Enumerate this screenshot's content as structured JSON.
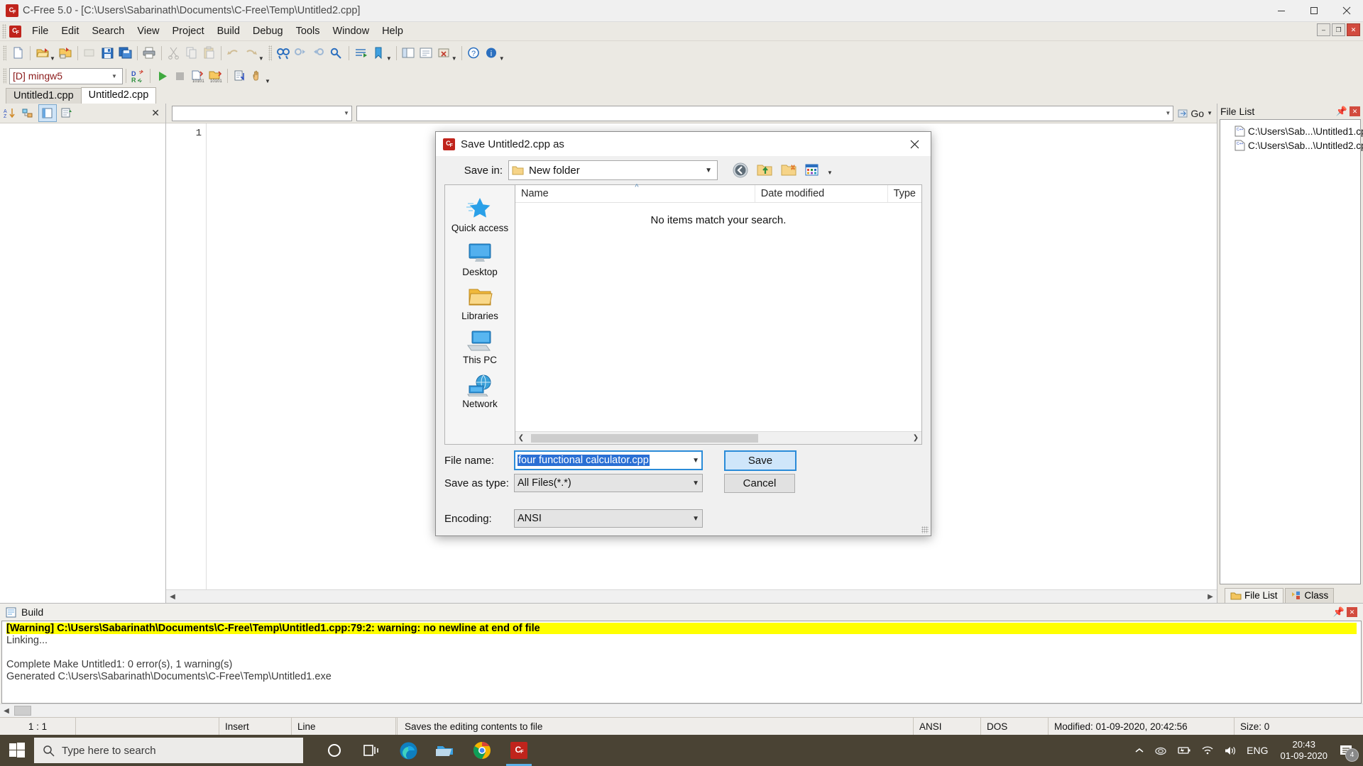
{
  "window": {
    "title": "C-Free 5.0 - [C:\\Users\\Sabarinath\\Documents\\C-Free\\Temp\\Untitled2.cpp]",
    "app_icon": "c-free-icon",
    "minimize": "minimize-button",
    "maximize": "maximize-button",
    "close": "close-button"
  },
  "menu": {
    "items": [
      {
        "label": "File"
      },
      {
        "label": "Edit"
      },
      {
        "label": "Search"
      },
      {
        "label": "View"
      },
      {
        "label": "Project"
      },
      {
        "label": "Build"
      },
      {
        "label": "Debug"
      },
      {
        "label": "Tools"
      },
      {
        "label": "Window"
      },
      {
        "label": "Help"
      }
    ],
    "mdi_buttons": [
      "–",
      "❐",
      "✕"
    ]
  },
  "toolbar2": {
    "compiler": "[D] mingw5"
  },
  "doc_tabs": [
    {
      "label": "Untitled1.cpp",
      "active": false
    },
    {
      "label": "Untitled2.cpp",
      "active": true
    }
  ],
  "editor": {
    "line_numbers": [
      "1"
    ],
    "go_label": "Go"
  },
  "file_list_panel": {
    "title": "File List",
    "items": [
      {
        "label": "C:\\Users\\Sab...\\Untitled1.cpp"
      },
      {
        "label": "C:\\Users\\Sab...\\Untitled2.cpp"
      }
    ],
    "tabs": [
      {
        "label": "File List",
        "active": true
      },
      {
        "label": "Class",
        "active": false
      }
    ]
  },
  "build_panel": {
    "title": "Build",
    "lines": [
      {
        "text": "[Warning] C:\\Users\\Sabarinath\\Documents\\C-Free\\Temp\\Untitled1.cpp:79:2: warning: no newline at end of file",
        "warning": true
      },
      {
        "text": "Linking...",
        "warning": false
      },
      {
        "text": "",
        "warning": false
      },
      {
        "text": "Complete Make Untitled1: 0 error(s), 1 warning(s)",
        "warning": false
      },
      {
        "text": "Generated C:\\Users\\Sabarinath\\Documents\\C-Free\\Temp\\Untitled1.exe",
        "warning": false
      }
    ]
  },
  "status_bar": {
    "position": "1 : 1",
    "blank1": "",
    "insert_mode": "Insert",
    "line_mode": "Line",
    "blank2": "",
    "hint": "Saves the editing contents to file",
    "encoding": "ANSI",
    "line_ending": "DOS",
    "modified": "Modified: 01-09-2020, 20:42:56",
    "size": "Size: 0"
  },
  "dialog": {
    "title": "Save Untitled2.cpp as",
    "icon": "c-free-icon",
    "close_label": "✕",
    "save_in_label": "Save in:",
    "save_in_value": "New folder",
    "toolbar_icons": [
      "back-icon",
      "up-folder-icon",
      "new-folder-icon",
      "views-icon"
    ],
    "places": [
      {
        "label": "Quick access",
        "icon": "quick-access-star-icon"
      },
      {
        "label": "Desktop",
        "icon": "desktop-icon"
      },
      {
        "label": "Libraries",
        "icon": "libraries-folder-icon"
      },
      {
        "label": "This PC",
        "icon": "this-pc-icon"
      },
      {
        "label": "Network",
        "icon": "network-globe-icon"
      }
    ],
    "columns": [
      {
        "label": "Name"
      },
      {
        "label": "Date modified"
      },
      {
        "label": "Type"
      }
    ],
    "empty_message": "No items match your search.",
    "file_name_label": "File name:",
    "file_name_value": "four functional calculator.cpp",
    "save_as_type_label": "Save as type:",
    "save_as_type_value": "All Files(*.*)",
    "encoding_label": "Encoding:",
    "encoding_value": "ANSI",
    "save_button": "Save",
    "cancel_button": "Cancel"
  },
  "taskbar": {
    "search_placeholder": "Type here to search",
    "apps": [
      {
        "name": "cortana-icon"
      },
      {
        "name": "task-view-icon"
      },
      {
        "name": "edge-icon"
      },
      {
        "name": "file-explorer-icon"
      },
      {
        "name": "chrome-icon"
      },
      {
        "name": "c-free-icon"
      }
    ],
    "tray": {
      "language": "ENG",
      "time": "20:43",
      "date": "01-09-2020",
      "notification_count": "4"
    }
  },
  "colors": {
    "accent": "#2a8bd8",
    "warning_bg": "#ffff00",
    "selection": "#2a6fd4",
    "brand_red": "#c0241c",
    "taskbar": "#4a4334"
  }
}
